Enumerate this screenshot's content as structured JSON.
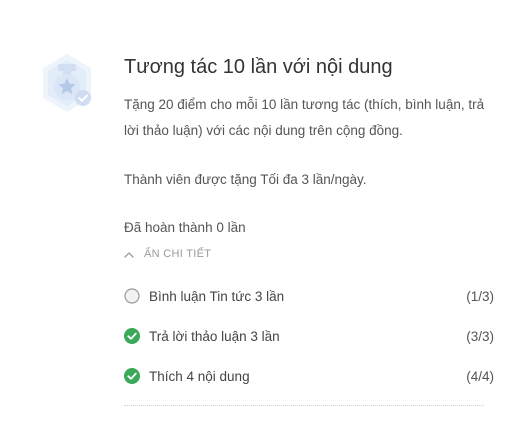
{
  "challenge": {
    "title": "Tương tác 10 lần với nội dung",
    "description": "Tặng 20 điểm cho mỗi 10 lần tương tác (thích, bình luận, trả lời thảo luận) với các nội dung trên cộng đồng.",
    "limit_text": "Thành viên được tặng Tối đa 3 lần/ngày.",
    "completed_text": "Đã hoàn thành 0 lần",
    "toggle_label": "ẨN CHI TIẾT",
    "badge_icon": "star-medal-badge-icon",
    "accent_color": "#3aaa5a",
    "tasks": [
      {
        "label": "Bình luận Tin tức 3 lần",
        "count": "(1/3)",
        "status": "incomplete"
      },
      {
        "label": "Trả lời thảo luận 3 lần",
        "count": "(3/3)",
        "status": "complete"
      },
      {
        "label": "Thích 4 nội dung",
        "count": "(4/4)",
        "status": "complete"
      }
    ]
  }
}
